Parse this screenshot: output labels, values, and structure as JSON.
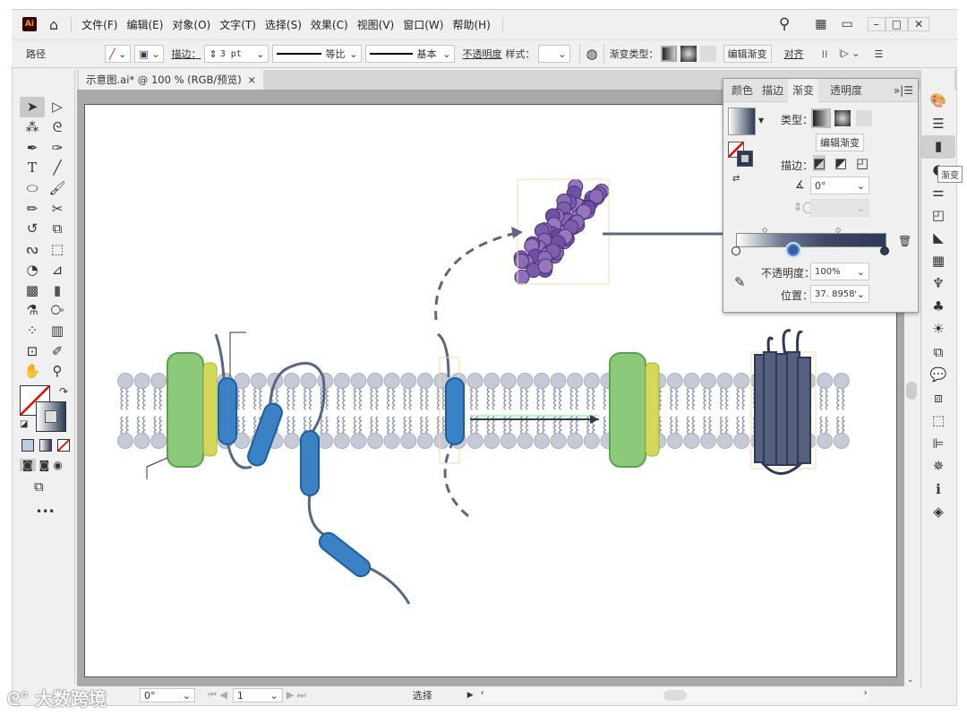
{
  "app": {
    "logo": "Ai",
    "menu": [
      "文件(F)",
      "编辑(E)",
      "对象(O)",
      "文字(T)",
      "选择(S)",
      "效果(C)",
      "视图(V)",
      "窗口(W)",
      "帮助(H)"
    ]
  },
  "control": {
    "object_type": "路径",
    "stroke_label": "描边：",
    "stroke_weight": "3 pt",
    "profile1": "等比",
    "profile2": "基本",
    "opacity_label": "不透明度",
    "style_label": "样式：",
    "gradient_type_label": "渐变类型：",
    "edit_gradient": "编辑渐变",
    "align": "对齐"
  },
  "document": {
    "tab_title": "示意图.ai* @ 100 % (RGB/预览)",
    "close": "×"
  },
  "gradient_panel": {
    "tabs": [
      "颜色",
      "描边",
      "渐变",
      "透明度"
    ],
    "active_tab": "渐变",
    "type_label": "类型：",
    "edit_gradient": "编辑渐变",
    "stroke_label": "描边：",
    "angle": "0°",
    "opacity_label": "不透明度：",
    "opacity": "100%",
    "location_label": "位置：",
    "location": "37. 8958%",
    "gradient_start": "#ffffff",
    "gradient_end": "#2d3a55",
    "selected_stop_percent": 37.8958
  },
  "dock": {
    "tooltip": "渐变"
  },
  "status": {
    "rotation": "0°",
    "artboard": "1",
    "tool": "选择"
  },
  "watermark": "大数跨境",
  "colors": {
    "protein_green": "#8dc97a",
    "helix_blue": "#3b82c4",
    "lipid": "#c5cad6",
    "tether": "#5a6782",
    "purple": "#6a4a9c"
  }
}
